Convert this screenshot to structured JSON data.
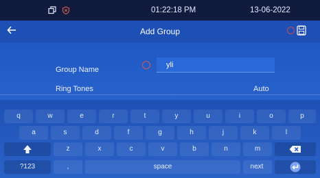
{
  "status_bar": {
    "time": "01:22:18 PM",
    "date": "13-06-2022",
    "icons": [
      "window-restore-icon",
      "shield-x-icon"
    ]
  },
  "header": {
    "title": "Add Group",
    "back_icon": "arrow-left-icon",
    "save_icon": "floppy-disk-icon"
  },
  "form": {
    "group_name_label": "Group Name",
    "group_name_value": "yli",
    "ring_tones_label": "Ring Tones",
    "ring_tones_value": "Auto"
  },
  "keyboard": {
    "row1": [
      "q",
      "w",
      "e",
      "r",
      "t",
      "y",
      "u",
      "i",
      "o",
      "p"
    ],
    "row2": [
      "a",
      "s",
      "d",
      "f",
      "g",
      "h",
      "j",
      "k",
      "l"
    ],
    "row3": [
      "z",
      "x",
      "c",
      "v",
      "b",
      "n",
      "m"
    ],
    "symbols_label": "?123",
    "comma_label": ",",
    "space_label": "space",
    "period_label": ".",
    "next_label": "next",
    "shift_icon": "shift-up-icon",
    "backspace_icon": "backspace-icon",
    "enter_icon": "enter-icon"
  },
  "colors": {
    "background": "#245dc8",
    "status_bar": "#101b3d",
    "accent_red": "#d35a4e"
  }
}
